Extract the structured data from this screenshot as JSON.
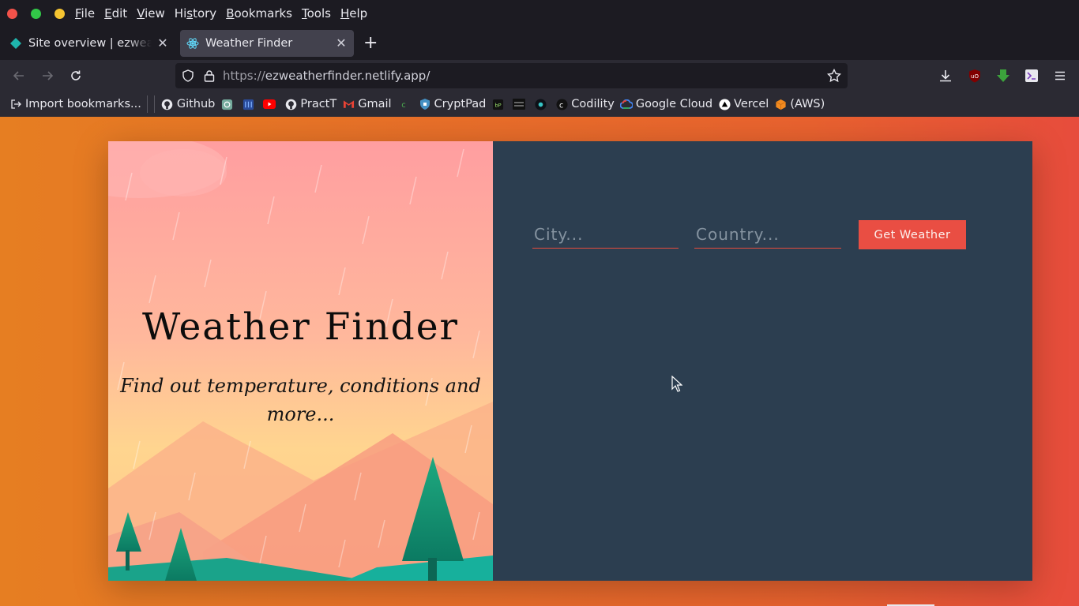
{
  "menu": {
    "items": [
      {
        "label_pre": "",
        "accel": "F",
        "label_post": "ile"
      },
      {
        "label_pre": "",
        "accel": "E",
        "label_post": "dit"
      },
      {
        "label_pre": "",
        "accel": "V",
        "label_post": "iew"
      },
      {
        "label_pre": "Hi",
        "accel": "s",
        "label_post": "tory"
      },
      {
        "label_pre": "",
        "accel": "B",
        "label_post": "ookmarks"
      },
      {
        "label_pre": "",
        "accel": "T",
        "label_post": "ools"
      },
      {
        "label_pre": "",
        "accel": "H",
        "label_post": "elp"
      }
    ]
  },
  "tabs": [
    {
      "title": "Site overview | ezweatherfinder",
      "favicon": "netlify-icon",
      "active": false
    },
    {
      "title": "Weather Finder",
      "favicon": "react-icon",
      "active": true
    }
  ],
  "urlbar": {
    "scheme": "https://",
    "host_path": "ezweatherfinder.netlify.app/"
  },
  "bookmarks": [
    {
      "label": "Import bookmarks...",
      "icon": "import-icon"
    },
    {
      "label": "Github",
      "icon": "github-icon"
    },
    {
      "label": "",
      "icon": "openai-icon"
    },
    {
      "label": "",
      "icon": "blue-app-icon"
    },
    {
      "label": "",
      "icon": "youtube-icon"
    },
    {
      "label": "PractT",
      "icon": "github-icon"
    },
    {
      "label": "Gmail",
      "icon": "gmail-icon"
    },
    {
      "label": "",
      "icon": "green-c-icon"
    },
    {
      "label": "CryptPad",
      "icon": "cryptpad-icon"
    },
    {
      "label": "",
      "icon": "bp-icon"
    },
    {
      "label": "",
      "icon": "dark-box-icon"
    },
    {
      "label": "",
      "icon": "dark-circle-icon"
    },
    {
      "label": "Codility",
      "icon": "codility-icon"
    },
    {
      "label": "Google Cloud",
      "icon": "google-cloud-icon"
    },
    {
      "label": "Vercel",
      "icon": "vercel-icon"
    },
    {
      "label": "(AWS)",
      "icon": "aws-icon"
    }
  ],
  "app": {
    "title": "Weather Finder",
    "subtitle": "Find out temperature, conditions and more...",
    "city_placeholder": "City...",
    "country_placeholder": "Country...",
    "button_label": "Get Weather"
  },
  "colors": {
    "accent": "#e74c3c",
    "panel": "#2c3e50",
    "background_start": "#e67e22",
    "background_end": "#e74c3c"
  }
}
